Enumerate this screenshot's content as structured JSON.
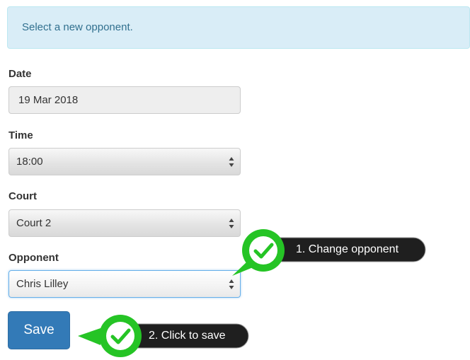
{
  "alert": {
    "message": "Select a new opponent."
  },
  "form": {
    "date": {
      "label": "Date",
      "value": "19 Mar 2018"
    },
    "time": {
      "label": "Time",
      "value": "18:00"
    },
    "court": {
      "label": "Court",
      "value": "Court 2"
    },
    "opponent": {
      "label": "Opponent",
      "value": "Chris Lilley"
    },
    "save_label": "Save"
  },
  "callouts": {
    "step1": "1. Change opponent",
    "step2": "2. Click to save"
  },
  "colors": {
    "alert_bg": "#d9edf7",
    "alert_text": "#31708f",
    "primary_button": "#337ab7",
    "callout_green": "#25c425",
    "callout_dark": "#1f1f1f"
  },
  "icons": {
    "select_caret": "up-down-caret-icon",
    "callout_check": "check-icon"
  }
}
